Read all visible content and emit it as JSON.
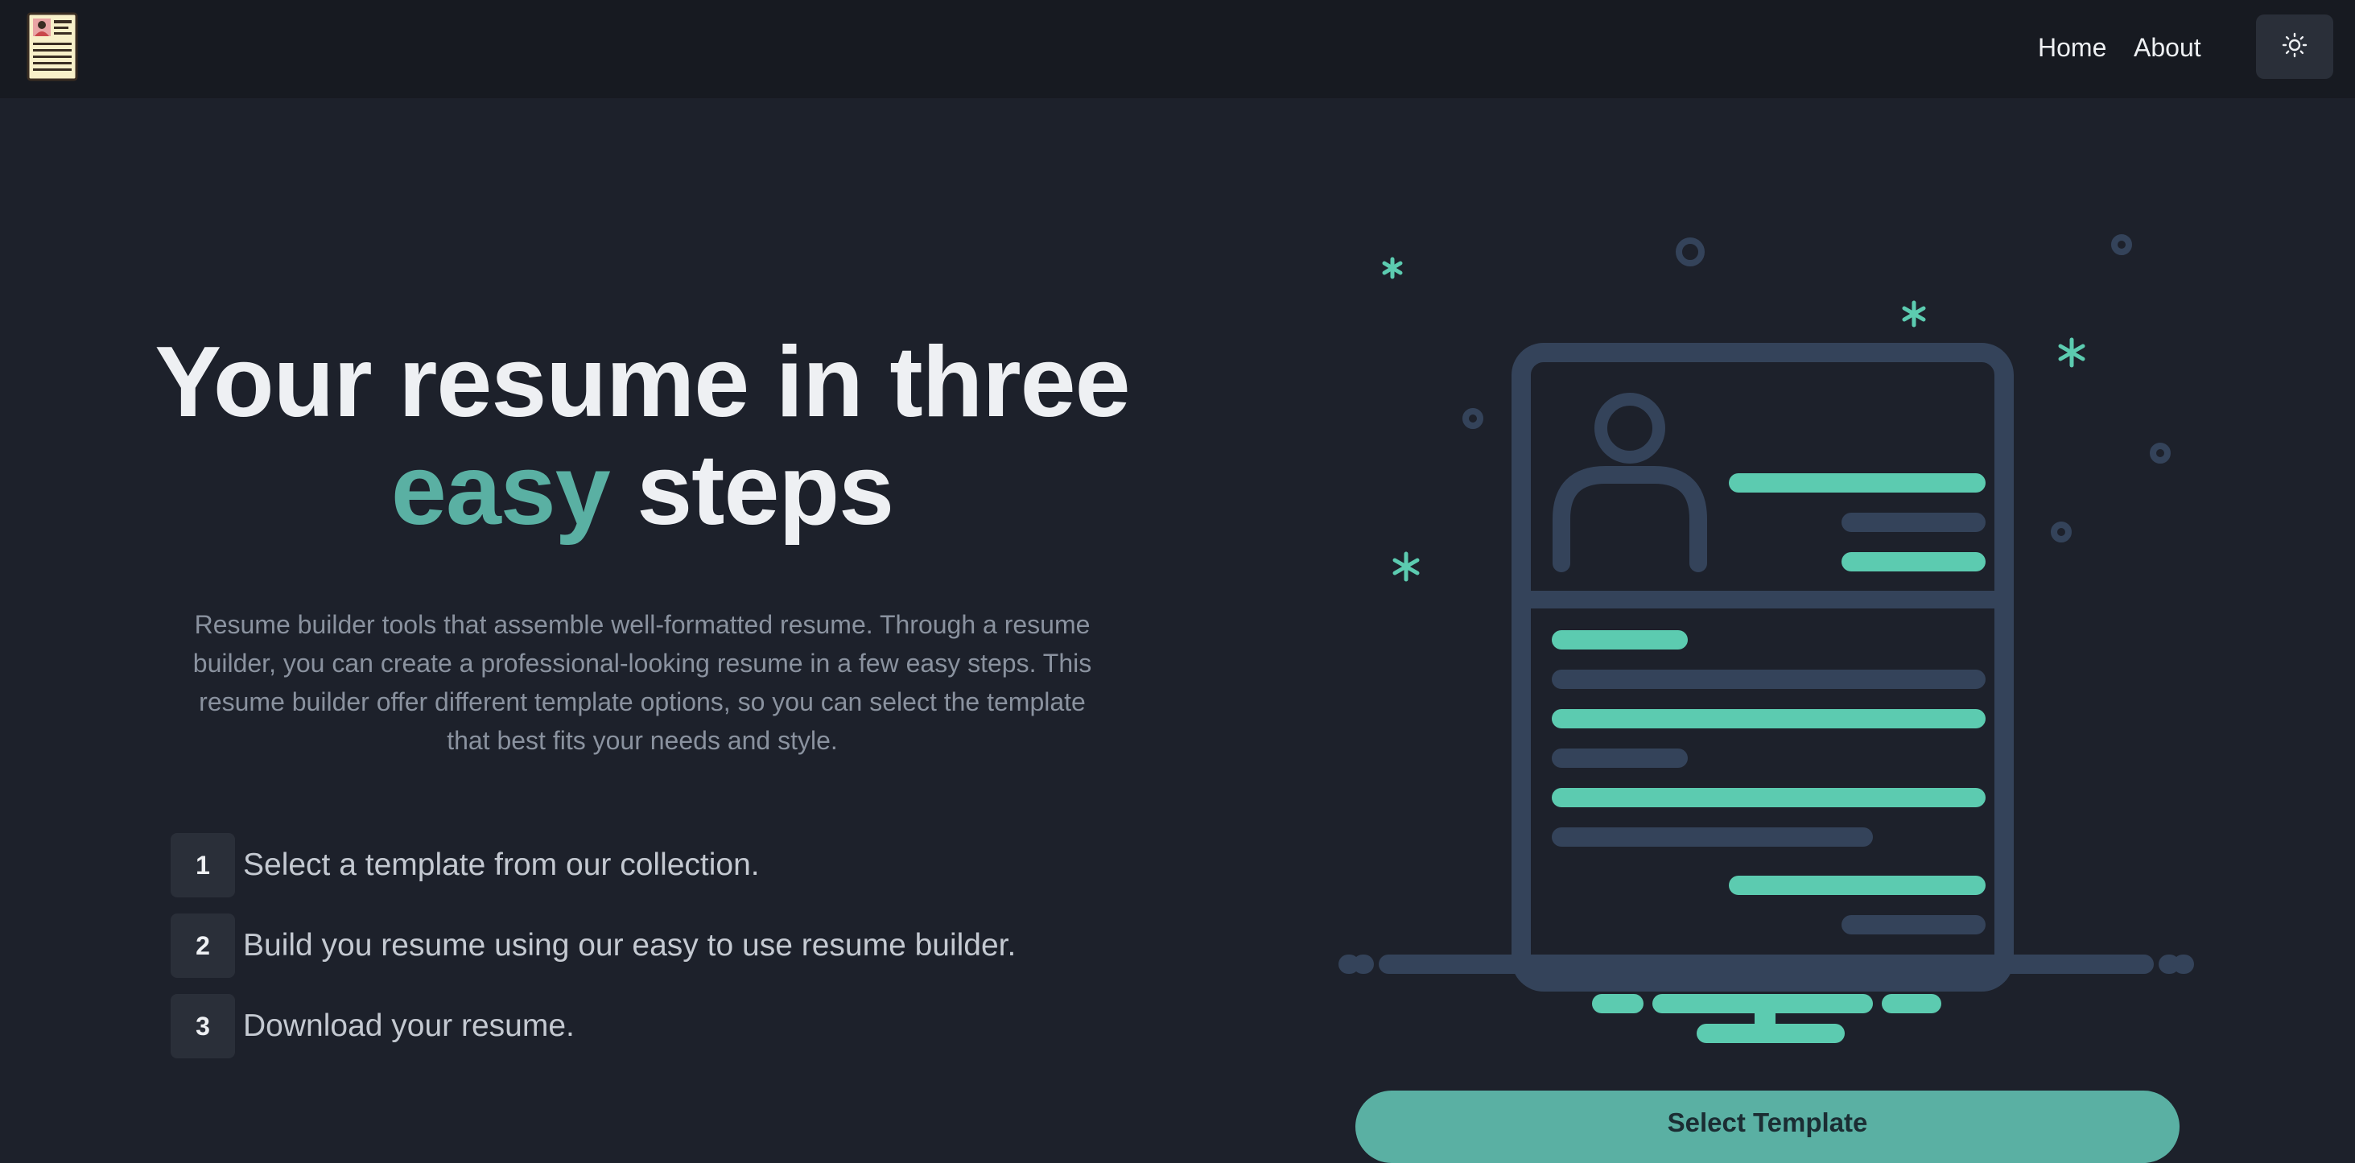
{
  "nav": {
    "logo_icon": "resume-document-icon",
    "links": [
      {
        "label": "Home"
      },
      {
        "label": "About"
      }
    ],
    "theme_toggle_icon": "sun-icon"
  },
  "hero": {
    "title_line1": "Your resume in three",
    "title_accent": "easy",
    "title_line2_rest": "steps",
    "description": "Resume builder tools that assemble well-formatted resume. Through a resume builder, you can create a professional-looking resume in a few easy steps. This resume builder offer different template options, so you can select the template that best fits your needs and style."
  },
  "steps": [
    {
      "number": "1",
      "text": "Select a template from our collection."
    },
    {
      "number": "2",
      "text": "Build you resume using our easy to use resume builder."
    },
    {
      "number": "3",
      "text": "Download your resume."
    }
  ],
  "illustration": {
    "icon": "resume-illustration-icon"
  },
  "cta": {
    "label": "Select Template"
  },
  "colors": {
    "background": "#1d212b",
    "navbar": "#171a21",
    "accent": "#5ab0a3",
    "illustration_teal": "#5ccbb0",
    "illustration_slate": "#34435a",
    "muted_text": "#8a929f"
  }
}
